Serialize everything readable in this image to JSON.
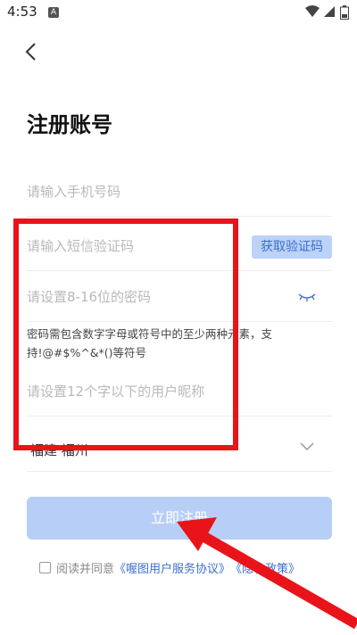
{
  "status_bar": {
    "time": "4:53",
    "notification_badge": "A"
  },
  "header": {
    "title": "注册账号"
  },
  "form": {
    "phone_placeholder": "请输入手机号码",
    "sms_placeholder": "请输入短信验证码",
    "sms_button_label": "获取验证码",
    "password_placeholder": "请设置8-16位的密码",
    "password_hint": "密码需包含数字字母或符号中的至少两种元素，支持!@#$%^&*()等符号",
    "nickname_placeholder": "请设置12个字以下的用户昵称",
    "region_value": "福建 福州"
  },
  "submit": {
    "label": "立即注册"
  },
  "agreement": {
    "prefix": "阅读并同意",
    "link1": "《喔图用户服务协议》",
    "link2": "《隐私政策》"
  },
  "colors": {
    "accent_light": "#b7cff6",
    "link": "#3c6fd0",
    "annotation": "#e8141a"
  },
  "icons": [
    "wifi-icon",
    "signal-icon",
    "battery-icon",
    "back-arrow-icon",
    "eye-closed-icon",
    "chevron-down-icon"
  ]
}
